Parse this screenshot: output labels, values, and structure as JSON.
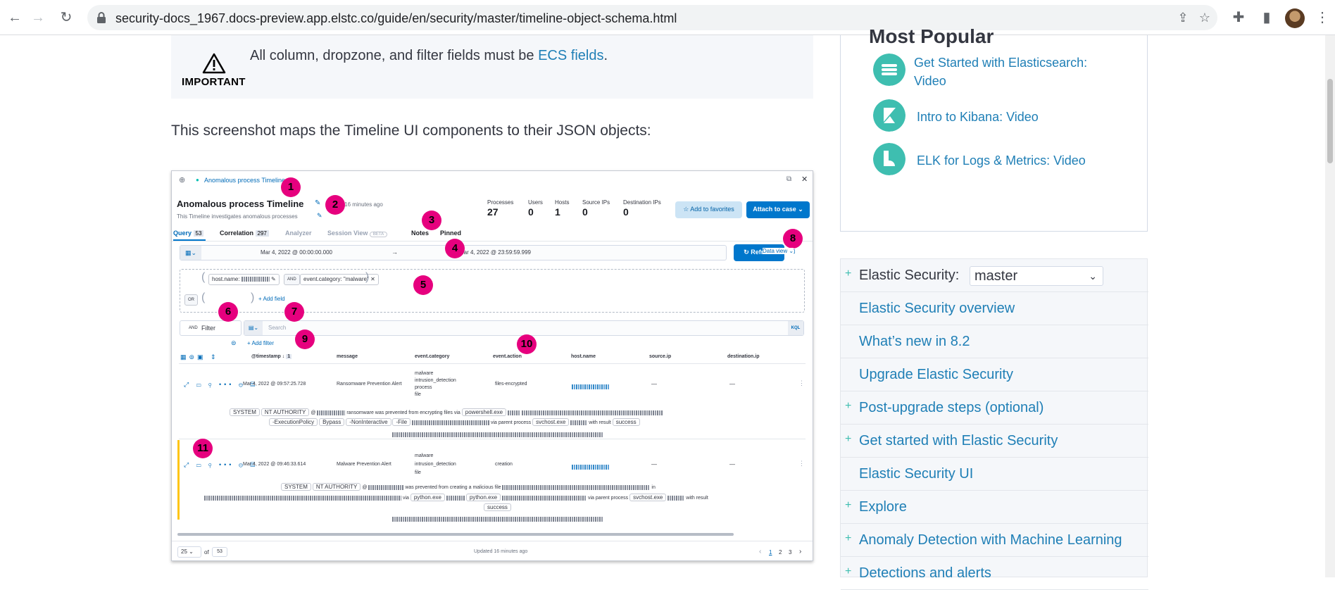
{
  "browser": {
    "url": "security-docs_1967.docs-preview.app.elstc.co/guide/en/security/master/timeline-object-schema.html",
    "icons": [
      "back-icon",
      "forward-icon",
      "reload-icon",
      "lock-icon",
      "share-icon",
      "star-icon",
      "extensions-icon",
      "side-panel-icon",
      "avatar",
      "menu-icon"
    ]
  },
  "important": {
    "label": "IMPORTANT",
    "text_before": "All column, dropzone, and filter fields must be ",
    "link": "ECS fields",
    "text_after": "."
  },
  "paragraph": "This screenshot maps the Timeline UI components to their JSON objects:",
  "timeline": {
    "breadcrumb": "Anomalous process Timeline",
    "title": "Anomalous process Timeline",
    "updated": "ed 16 minutes ago",
    "description": "This Timeline investigates anomalous processes",
    "stats": [
      {
        "label": "Processes",
        "value": "27"
      },
      {
        "label": "Users",
        "value": "0"
      },
      {
        "label": "Hosts",
        "value": "1"
      },
      {
        "label": "Source IPs",
        "value": "0"
      },
      {
        "label": "Destination IPs",
        "value": "0"
      }
    ],
    "favorites_button": "Add to favorites",
    "attach_button": "Attach to case",
    "tabs": {
      "query": "Query",
      "query_count": "53",
      "correlation": "Correlation",
      "correlation_count": "297",
      "analyzer": "Analyzer",
      "session": "Session View",
      "session_badge": "BETA",
      "notes": "Notes",
      "pinned": "Pinned"
    },
    "date_start": "Mar 4, 2022 @ 00:00:00.000",
    "date_arrow": "→",
    "date_end": "Mar 4, 2022 @ 23:59:59.999",
    "refresh": "Refresh",
    "data_view": "Data view",
    "dropzone": {
      "pill1": "host.name: ",
      "and": "AND",
      "pill2": "event.category: \"malware\"",
      "or": "OR",
      "add_field": "+ Add field"
    },
    "filter": {
      "and": "AND",
      "label": "Filter",
      "search_placeholder": "Search",
      "kql": "KQL",
      "add_filter": "+ Add filter"
    },
    "columns": [
      "@timestamp",
      "message",
      "event.category",
      "event.action",
      "host.name",
      "source.ip",
      "destination.ip"
    ],
    "sort_count": "1",
    "rows": [
      {
        "timestamp": "Mar 4, 2022 @ 09:57:25.728",
        "message": "Ransomware Prevention Alert",
        "categories": [
          "malware",
          "intrusion_detection",
          "process",
          "file"
        ],
        "action": "files-encrypted",
        "source_ip": "—",
        "dest_ip": "—",
        "detail_user": "SYSTEM",
        "detail_domain": "NT AUTHORITY",
        "detail_text": "ransomware was prevented from encrypting files via",
        "detail_exe": "powershell.exe",
        "detail_args": [
          "-ExecutionPolicy",
          "Bypass",
          "-NonInteractive",
          "-File"
        ],
        "detail_parent_label": "via parent process",
        "detail_parent": "svchost.exe",
        "detail_result_label": "with result",
        "detail_result": "success"
      },
      {
        "timestamp": "Mar 4, 2022 @ 09:46:33.614",
        "message": "Malware Prevention Alert",
        "categories": [
          "malware",
          "intrusion_detection",
          "file"
        ],
        "action": "creation",
        "source_ip": "—",
        "dest_ip": "—",
        "detail_user": "SYSTEM",
        "detail_domain": "NT AUTHORITY",
        "detail_text": "was prevented from creating a malicious file",
        "detail_in": "in",
        "detail_via": "via",
        "detail_exe": "python.exe",
        "detail_exe2": "python.exe",
        "detail_parent_label": "via parent process",
        "detail_parent": "svchost.exe",
        "detail_result_label": "with result",
        "detail_result": "success"
      }
    ],
    "footer": {
      "per_page": "25",
      "of": "of",
      "total": "53",
      "updated": "Updated 16 minutes ago",
      "pages": [
        "1",
        "2",
        "3"
      ]
    },
    "callouts": [
      "1",
      "2",
      "3",
      "4",
      "5",
      "6",
      "7",
      "8",
      "9",
      "10",
      "11"
    ]
  },
  "sidebar": {
    "popular_title": "Most Popular",
    "popular": [
      {
        "label_line1": "Get Started with Elasticsearch:",
        "label_line2": "Video"
      },
      {
        "label_line1": "Intro to Kibana: Video"
      },
      {
        "label_line1": "ELK for Logs & Metrics: Video"
      }
    ],
    "version_label": "Elastic Security:",
    "version_value": "master",
    "toc": [
      {
        "label": "Elastic Security overview",
        "expandable": false
      },
      {
        "label": "What’s new in 8.2",
        "expandable": false
      },
      {
        "label": "Upgrade Elastic Security",
        "expandable": false
      },
      {
        "label": "Post-upgrade steps (optional)",
        "expandable": true
      },
      {
        "label": "Get started with Elastic Security",
        "expandable": true
      },
      {
        "label": "Elastic Security UI",
        "expandable": false
      },
      {
        "label": "Explore",
        "expandable": true
      },
      {
        "label": "Anomaly Detection with Machine Learning",
        "expandable": true
      },
      {
        "label": "Detections and alerts",
        "expandable": true
      }
    ]
  },
  "colors": {
    "link": "#1f7fb6",
    "accent": "#3ebeb0",
    "callout": "#e6007e",
    "primary_button": "#0077cc"
  }
}
